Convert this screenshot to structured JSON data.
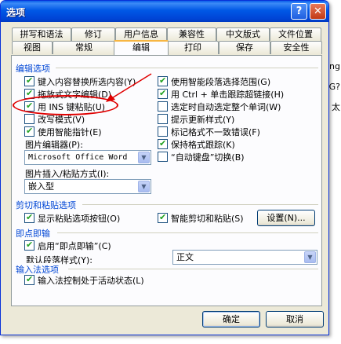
{
  "background": {
    "fragments": [
      "ing",
      "G?",
      "太"
    ]
  },
  "window": {
    "title": "选项",
    "help_glyph": "?",
    "close_glyph": "✕"
  },
  "tabs": {
    "row1": [
      "拼写和语法",
      "修订",
      "用户信息",
      "兼容性",
      "中文版式",
      "文件位置"
    ],
    "row2": [
      "视图",
      "常规",
      "编辑",
      "打印",
      "保存",
      "安全性"
    ],
    "active": "编辑"
  },
  "sections": {
    "editing": {
      "title": "编辑选项",
      "left": [
        {
          "label": "键入内容替换所选内容(Y)",
          "checked": true
        },
        {
          "label": "拖放式文字编辑(D)",
          "checked": true
        },
        {
          "label": "用 INS 键粘贴(U)",
          "checked": true
        },
        {
          "label": "改写模式(V)",
          "checked": false
        },
        {
          "label": "使用智能指针(E)",
          "checked": true
        }
      ],
      "right": [
        {
          "label": "使用智能段落选择范围(G)",
          "checked": true
        },
        {
          "label": "用 Ctrl + 单击跟踪超链接(H)",
          "checked": true
        },
        {
          "label": "选定时自动选定整个单词(W)",
          "checked": false
        },
        {
          "label": "提示更新样式(Y)",
          "checked": false
        },
        {
          "label": "标记格式不一致错误(F)",
          "checked": false
        },
        {
          "label": "保持格式跟踪(K)",
          "checked": true
        },
        {
          "label": "“自动键盘”切换(B)",
          "checked": false
        }
      ],
      "picture_editor_label": "图片编辑器(P):",
      "picture_editor_value": "Microsoft Office Word",
      "insert_paste_label": "图片插入/粘贴方式(I):",
      "insert_paste_value": "嵌入型"
    },
    "cut_paste": {
      "title": "剪切和粘贴选项",
      "show_paste_options": {
        "label": "显示粘贴选项按钮(O)",
        "checked": true
      },
      "smart_cut_paste": {
        "label": "智能剪切和粘贴(S)",
        "checked": true
      },
      "settings_button": "设置(N)..."
    },
    "click_and_type": {
      "title": "即点即输",
      "enable": {
        "label": "启用“即点即输”(C)",
        "checked": true
      },
      "default_style_label": "默认段落样式(Y):",
      "default_style_value": "正文"
    },
    "ime": {
      "title": "输入法选项",
      "ime_control": {
        "label": "输入法控制处于活动状态(L)",
        "checked": true
      }
    }
  },
  "buttons": {
    "ok": "确定",
    "cancel": "取消"
  },
  "colors": {
    "title_bar": "#0058e6",
    "section_title": "#0046d5",
    "annotation": "#e00000",
    "check": "#21a121"
  }
}
